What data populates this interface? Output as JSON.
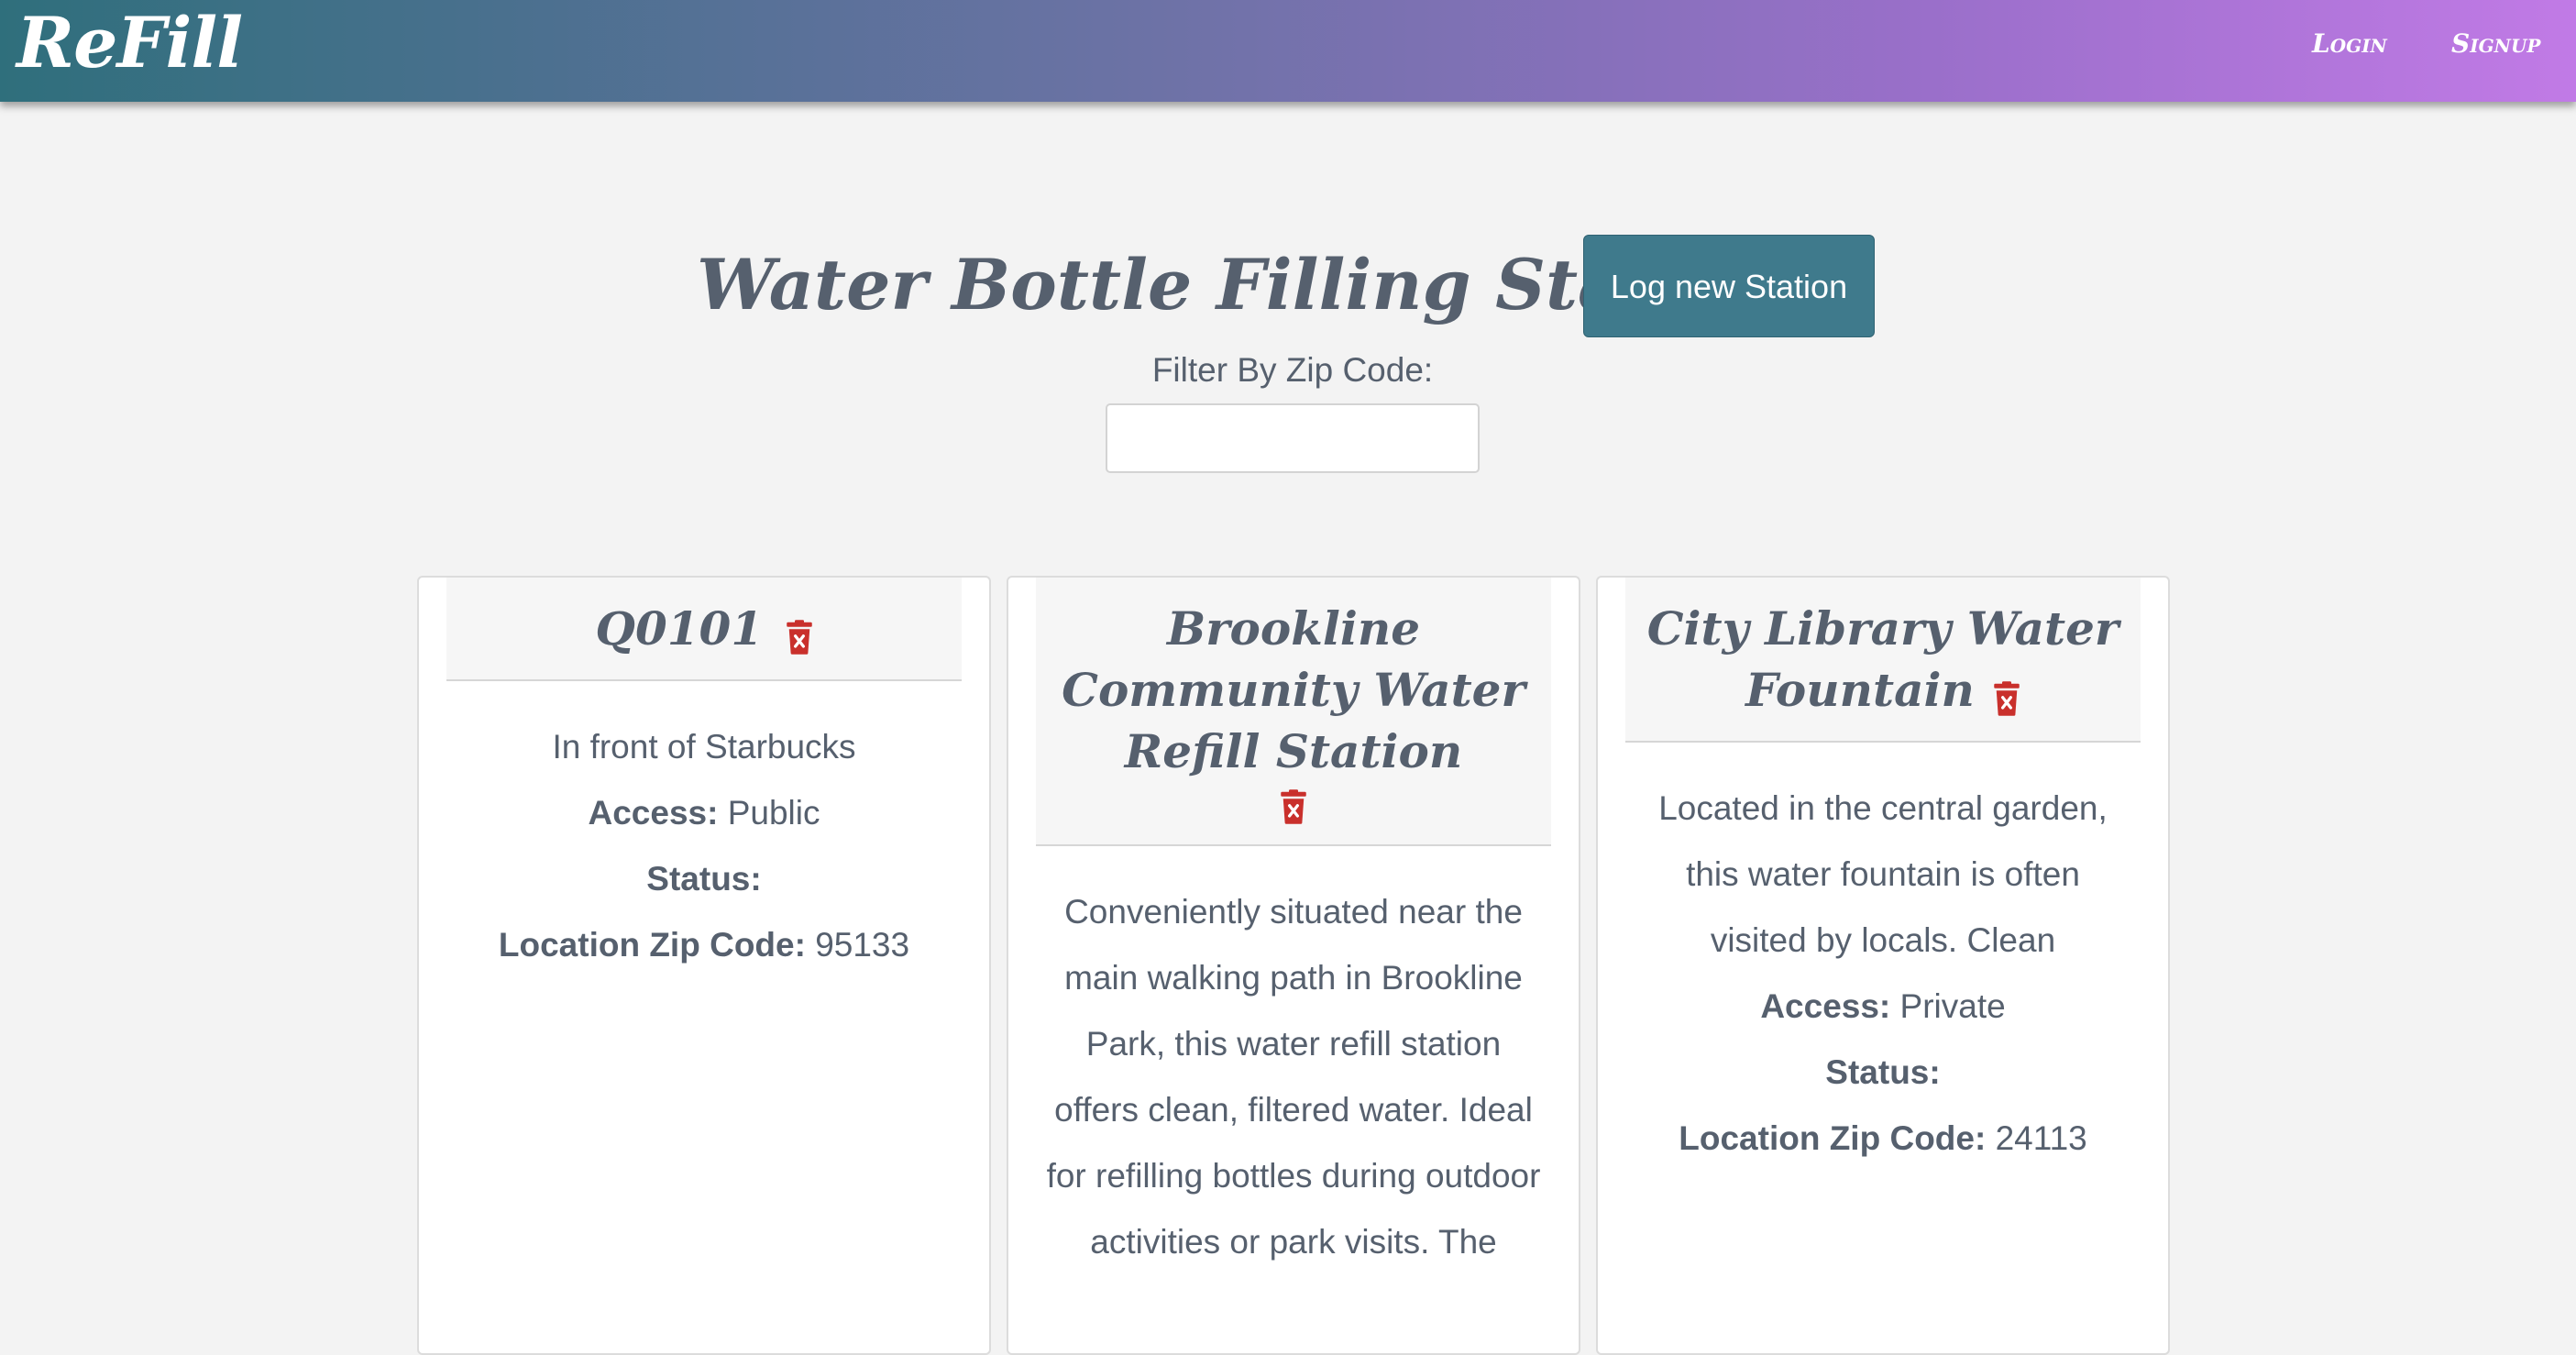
{
  "nav": {
    "brand": "ReFill",
    "login": "Login",
    "signup": "Signup"
  },
  "header": {
    "title": "Water Bottle Filling Stations",
    "log_button": "Log new Station",
    "filter_label": "Filter By Zip Code:",
    "filter_value": ""
  },
  "labels": {
    "access": "Access:",
    "status": "Status:",
    "zip": "Location Zip Code:"
  },
  "stations": [
    {
      "name": "Q0101",
      "description": "In front of Starbucks",
      "access": "Public",
      "status": "",
      "zip": "95133"
    },
    {
      "name": "Brookline Community Water Refill Station",
      "description": "Conveniently situated near the main walking path in Brookline Park, this water refill station offers clean, filtered water. Ideal for refilling bottles during outdoor activities or park visits. The"
    },
    {
      "name": "City Library Water Fountain",
      "description": "Located in the central garden, this water fountain is often visited by locals. Clean",
      "access": "Private",
      "status": "",
      "zip": "24113"
    }
  ],
  "icons": {
    "delete": "trash-icon"
  },
  "colors": {
    "nav_gradient_start": "#2f6f7c",
    "nav_gradient_end": "#c17ae6",
    "button": "#3f7a8c",
    "delete_icon": "#c9302c",
    "text": "#56606e"
  }
}
